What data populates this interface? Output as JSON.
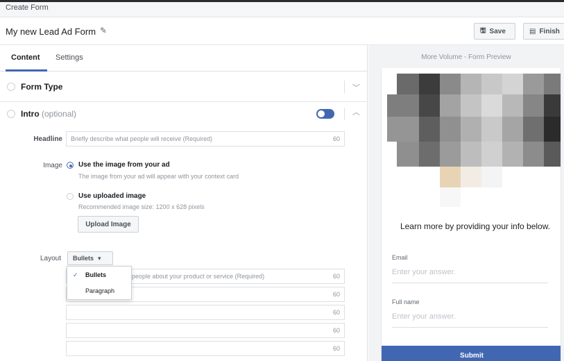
{
  "window": {
    "title": "Create Form"
  },
  "form": {
    "name": "My new Lead Ad Form"
  },
  "toolbar": {
    "save_label": "Save",
    "finish_label": "Finish"
  },
  "tabs": [
    {
      "label": "Content",
      "active": true
    },
    {
      "label": "Settings",
      "active": false
    }
  ],
  "sections": {
    "form_type": {
      "title": "Form Type"
    },
    "intro": {
      "title": "Intro",
      "optional": "(optional)",
      "enabled": true
    }
  },
  "headline": {
    "label": "Headline",
    "placeholder": "Briefly describe what people will receive (Required)",
    "count": "60"
  },
  "image": {
    "label": "Image",
    "option1": {
      "title": "Use the image from your ad",
      "subtitle": "The image from your ad will appear with your context card",
      "selected": true
    },
    "option2": {
      "title": "Use uploaded image",
      "subtitle": "Recommended image size: 1200 x 628 pixels",
      "selected": false
    },
    "upload_label": "Upload Image"
  },
  "layout": {
    "label": "Layout",
    "selected": "Bullets",
    "options": [
      "Bullets",
      "Paragraph"
    ],
    "bullet_placeholder": "people about your product or service (Required)",
    "counts": [
      "60",
      "60",
      "60",
      "60",
      "60"
    ]
  },
  "preview": {
    "title": "More Volume - Form Preview",
    "learn_more": "Learn more by providing your info below.",
    "fields": [
      {
        "label": "Email",
        "placeholder": "Enter your answer."
      },
      {
        "label": "Full name",
        "placeholder": "Enter your answer."
      }
    ],
    "submit_label": "Submit"
  },
  "colors": {
    "accent": "#4267b2",
    "border": "#dddfe2",
    "preview_bg": "#f2f3f5"
  }
}
